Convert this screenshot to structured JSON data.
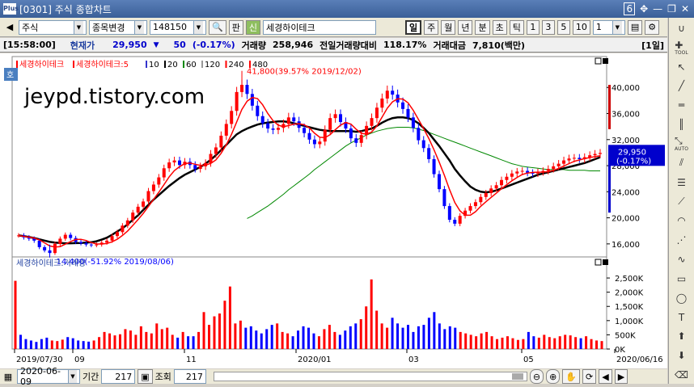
{
  "window": {
    "title": "[0301] 주식 종합차트",
    "logo": "Plus",
    "page_num": "6"
  },
  "toolbar": {
    "market": "주식",
    "change_label": "종목변경",
    "code": "148150",
    "pan_label": "판",
    "search_tag": "신",
    "stock_name": "세경하이테크",
    "period_buttons": [
      "일",
      "주",
      "월",
      "년",
      "분",
      "초",
      "틱"
    ],
    "active_period": "일",
    "interval_buttons": [
      "1",
      "3",
      "5",
      "10"
    ],
    "interval_value": "1"
  },
  "pricebar": {
    "time": "[15:58:00]",
    "cur_label": "현재가",
    "price": "29,950",
    "arrow": "▼",
    "change": "50",
    "change_pct": "(-0.17%)",
    "volume_label": "거래량",
    "volume": "258,946",
    "prev_vol_label": "전일거래량대비",
    "prev_vol": "118.17%",
    "amount_label": "거래대금",
    "amount": "7,810(백만)",
    "period_tag": "[1일]"
  },
  "chart_data": [
    {
      "type": "line",
      "title": "",
      "legend": [
        {
          "name": "세경하이테크",
          "color": "#ff0000"
        },
        {
          "name": "세경하이테크:5",
          "color": "#ff0000"
        },
        {
          "name": "10",
          "color": "#3333cc"
        },
        {
          "name": "20",
          "color": "#000000"
        },
        {
          "name": "60",
          "color": "#008800"
        },
        {
          "name": "120",
          "color": "#999999"
        },
        {
          "name": "240",
          "color": "#ff0000"
        },
        {
          "name": "480",
          "color": "#ff0000"
        }
      ],
      "hoga_tag": "호",
      "ylim": [
        14000,
        43500
      ],
      "yticks": [
        "40,000",
        "36,000",
        "32,000",
        "28,000",
        "24,000",
        "20,000",
        "16,000"
      ],
      "current_price": "29,950",
      "current_pct": "(-0.17%)",
      "high_annot": "41,800(39.57% 2019/12/02)",
      "low_annot": "14,400(-51.92% 2019/08/06)",
      "close": [
        17300,
        17000,
        16800,
        16500,
        15500,
        15000,
        14600,
        16000,
        16800,
        17400,
        16900,
        16300,
        16100,
        15900,
        15800,
        15900,
        16200,
        16500,
        17200,
        17800,
        18800,
        19600,
        20800,
        21700,
        22500,
        24100,
        25100,
        26200,
        27600,
        28500,
        28800,
        28100,
        28600,
        28100,
        27500,
        27900,
        28400,
        29800,
        30800,
        32600,
        34400,
        36400,
        39300,
        40400,
        39000,
        37200,
        35600,
        34500,
        33700,
        33500,
        33800,
        34400,
        35400,
        34800,
        33800,
        33000,
        32000,
        31300,
        31700,
        33500,
        35300,
        35900,
        34700,
        33700,
        32200,
        31500,
        32700,
        34100,
        35300,
        36900,
        38300,
        39500,
        38900,
        37700,
        36700,
        35400,
        33800,
        31900,
        30700,
        29000,
        26700,
        24400,
        21800,
        19700,
        19100,
        20300,
        21100,
        21800,
        22400,
        23200,
        23800,
        24500,
        25000,
        25800,
        26300,
        26800,
        27100,
        27200,
        26900,
        26800,
        27000,
        27200,
        27500,
        27900,
        28300,
        28800,
        29100,
        29200,
        29000,
        29300,
        29600,
        29800,
        29950
      ],
      "ma20": [
        17300,
        17200,
        17050,
        16900,
        16700,
        16500,
        16300,
        16200,
        16150,
        16100,
        16100,
        16120,
        16150,
        16200,
        16250,
        16400,
        16650,
        16950,
        17400,
        17900,
        18400,
        19000,
        19700,
        20400,
        21200,
        22000,
        22800,
        23500,
        24200,
        24900,
        25500,
        26100,
        26600,
        27000,
        27400,
        27800,
        28300,
        28900,
        29600,
        30400,
        31200,
        32000,
        32800,
        33300,
        33700,
        34000,
        34300,
        34500,
        34600,
        34700,
        34800,
        34800,
        34700,
        34500,
        34300,
        34100,
        33900,
        33700,
        33500,
        33400,
        33300,
        33300,
        33300,
        33300,
        33300,
        33200,
        33300,
        33500,
        33700,
        34100,
        34600,
        35000,
        35300,
        35400,
        35400,
        35300,
        35000,
        34500,
        33800,
        33000,
        32000,
        31000,
        29900,
        28800,
        27500,
        26500,
        25600,
        24800,
        24300,
        24000,
        23900,
        24000,
        24200,
        24500,
        24800,
        25100,
        25400,
        25700,
        26000,
        26300,
        26600,
        26800,
        27000,
        27200,
        27400,
        27600,
        27800,
        28000,
        28200,
        28400,
        28700,
        29000,
        29300
      ],
      "ma60": [
        null,
        null,
        null,
        null,
        null,
        null,
        null,
        null,
        null,
        null,
        null,
        null,
        null,
        null,
        null,
        null,
        null,
        null,
        null,
        null,
        null,
        null,
        null,
        null,
        null,
        null,
        null,
        null,
        null,
        null,
        null,
        null,
        null,
        null,
        null,
        null,
        null,
        null,
        null,
        null,
        null,
        null,
        null,
        null,
        19900,
        20300,
        20800,
        21300,
        21800,
        22400,
        23000,
        23600,
        24300,
        24900,
        25500,
        26100,
        26700,
        27400,
        28000,
        28600,
        29200,
        29800,
        30400,
        31000,
        31500,
        31900,
        32300,
        32700,
        33000,
        33300,
        33500,
        33700,
        33800,
        33900,
        33900,
        33900,
        33800,
        33600,
        33400,
        33100,
        32800,
        32500,
        32200,
        31900,
        31600,
        31300,
        31000,
        30700,
        30400,
        30100,
        29800,
        29500,
        29200,
        28900,
        28600,
        28300,
        28100,
        27900,
        27800,
        27700,
        27600,
        27500,
        27400,
        27400,
        27400,
        27400,
        27300,
        27300,
        27300,
        27300,
        27200,
        27200,
        27200
      ]
    },
    {
      "type": "bar",
      "title": "세경하이테크:거래량",
      "ylim": [
        0,
        2900
      ],
      "yticks": [
        "2,500K",
        "2,000K",
        "1,500K",
        "1,000K",
        "500K",
        "0K"
      ],
      "x_labels": [
        "2019/07/30",
        "09",
        "11",
        "2020/01",
        "03",
        "05",
        "2020/06/16"
      ],
      "volume": [
        2400,
        500,
        350,
        300,
        250,
        350,
        400,
        300,
        280,
        330,
        420,
        380,
        300,
        280,
        260,
        300,
        420,
        600,
        550,
        480,
        520,
        700,
        650,
        500,
        800,
        600,
        550,
        900,
        700,
        750,
        500,
        400,
        600,
        450,
        450,
        600,
        1300,
        850,
        1150,
        1250,
        1700,
        2200,
        900,
        1000,
        750,
        800,
        650,
        550,
        700,
        850,
        900,
        600,
        550,
        450,
        650,
        800,
        750,
        550,
        450,
        700,
        850,
        600,
        500,
        650,
        800,
        900,
        1050,
        1500,
        2450,
        1350,
        900,
        750,
        1100,
        900,
        750,
        850,
        600,
        800,
        850,
        1100,
        1300,
        900,
        700,
        800,
        750,
        600,
        550,
        500,
        450,
        550,
        600,
        450,
        350,
        400,
        450,
        380,
        320,
        350,
        600,
        450,
        400,
        500,
        420,
        380,
        450,
        500,
        480,
        420,
        380,
        450,
        350,
        300,
        280
      ]
    }
  ],
  "bottombar": {
    "date": "2020-06-09",
    "period_label": "기간",
    "period": "217",
    "view_label": "조회",
    "view": "217"
  },
  "rightpanel": {
    "labels": [
      "TOOL",
      "AUTO"
    ]
  }
}
